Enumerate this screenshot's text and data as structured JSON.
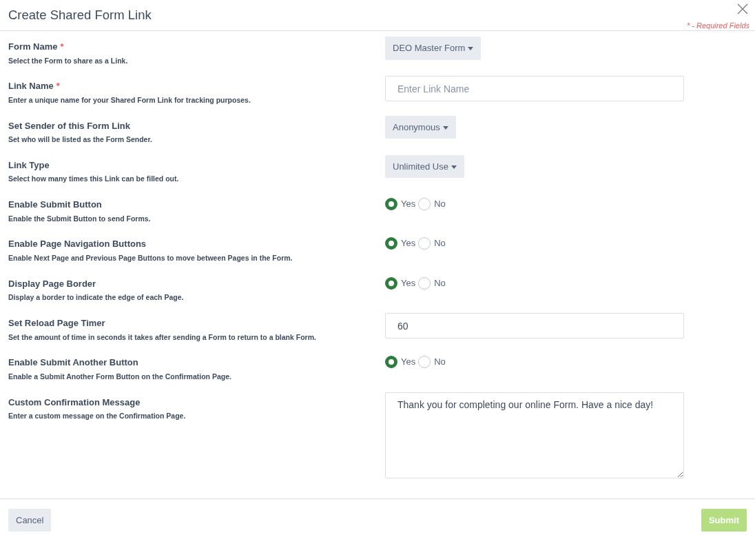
{
  "dialog": {
    "title": "Create Shared Form Link",
    "required_note": "* - Required Fields"
  },
  "fields": [
    {
      "label": "Form Name",
      "required_mark": "*",
      "description": "Select the Form to share as a Link.",
      "kind": "dropdown",
      "value": "DEO Master Form"
    },
    {
      "label": "Link Name",
      "required_mark": "*",
      "description": "Enter a unique name for your Shared Form Link for tracking purposes.",
      "kind": "text",
      "placeholder": "Enter Link Name"
    },
    {
      "label": "Set Sender of this Form Link",
      "description": "Set who will be listed as the Form Sender.",
      "kind": "dropdown",
      "value": "Anonymous"
    },
    {
      "label": "Link Type",
      "description": "Select how many times this Link can be filled out.",
      "kind": "dropdown",
      "value": "Unlimited Use"
    },
    {
      "label": "Enable Submit Button",
      "description": "Enable the Submit Button to send Forms.",
      "kind": "radio",
      "options": [
        {
          "label": "Yes",
          "selected": true
        },
        {
          "label": "No",
          "selected": false
        }
      ]
    },
    {
      "label": "Enable Page Navigation Buttons",
      "description": "Enable Next Page and Previous Page Buttons to move between Pages in the Form.",
      "kind": "radio",
      "options": [
        {
          "label": "Yes",
          "selected": true
        },
        {
          "label": "No",
          "selected": false
        }
      ]
    },
    {
      "label": "Display Page Border",
      "description": "Display a border to indicate the edge of each Page.",
      "kind": "radio",
      "options": [
        {
          "label": "Yes",
          "selected": true
        },
        {
          "label": "No",
          "selected": false
        }
      ]
    },
    {
      "label": "Set Reload Page Timer",
      "description": "Set the amount of time in seconds it takes after sending a Form to return to a blank Form.",
      "kind": "text",
      "value": "60"
    },
    {
      "label": "Enable Submit Another Button",
      "description": "Enable a Submit Another Form Button on the Confirmation Page.",
      "kind": "radio",
      "options": [
        {
          "label": "Yes",
          "selected": true
        },
        {
          "label": "No",
          "selected": false
        }
      ]
    },
    {
      "label": "Custom Confirmation Message",
      "description": "Enter a custom message on the Confirmation Page.",
      "kind": "textarea",
      "value": "Thank you for completing our online Form. Have a nice day!"
    }
  ],
  "footer": {
    "cancel": "Cancel",
    "submit": {
      "label": "Submit",
      "disabled": true
    }
  }
}
